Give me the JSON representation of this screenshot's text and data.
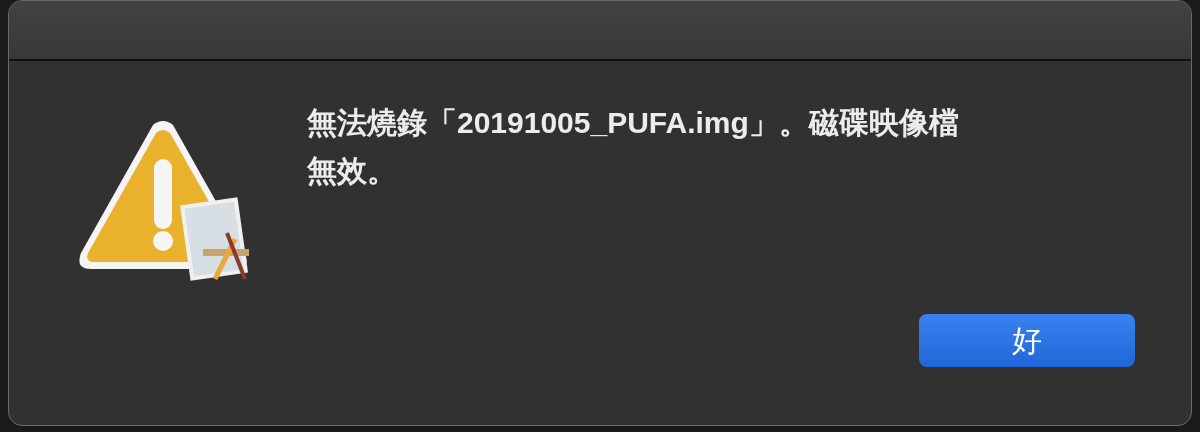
{
  "dialog": {
    "message": "無法燒錄「20191005_PUFA.img」。磁碟映像檔無效。",
    "buttons": [
      {
        "label": "好",
        "default": true
      }
    ]
  }
}
